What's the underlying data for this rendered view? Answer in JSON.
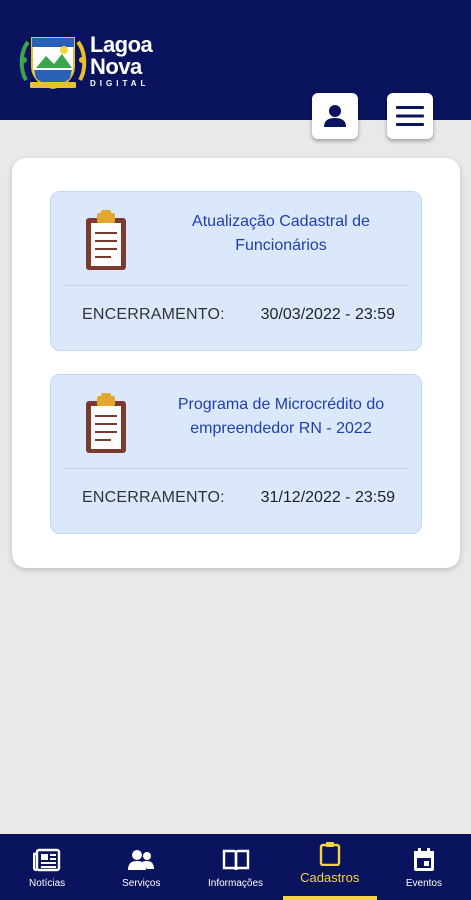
{
  "brand": {
    "line1": "Lagoa",
    "line2": "Nova",
    "line3": "DIGITAL"
  },
  "header": {
    "user_button_icon": "user-icon",
    "menu_button_icon": "hamburger-icon"
  },
  "registrations": [
    {
      "title": "Atualização Cadastral de Funcionários",
      "closing_label": "ENCERRAMENTO:",
      "closing_value": "30/03/2022 - 23:59",
      "icon": "clipboard-icon"
    },
    {
      "title": "Programa de Microcrédito do empreendedor RN - 2022",
      "closing_label": "ENCERRAMENTO:",
      "closing_value": "31/12/2022 - 23:59",
      "icon": "clipboard-icon"
    }
  ],
  "bottom_nav": {
    "items": [
      {
        "label": "Notícias",
        "icon": "newspaper-icon"
      },
      {
        "label": "Serviços",
        "icon": "people-icon"
      },
      {
        "label": "Informações",
        "icon": "book-icon"
      },
      {
        "label": "Cadastros",
        "icon": "clipboard-icon",
        "active": true
      },
      {
        "label": "Eventos",
        "icon": "calendar-icon"
      }
    ]
  },
  "colors": {
    "primary": "#0a135e",
    "accent": "#f5d442",
    "card": "#dbe8fb",
    "title": "#1f3fb0"
  }
}
